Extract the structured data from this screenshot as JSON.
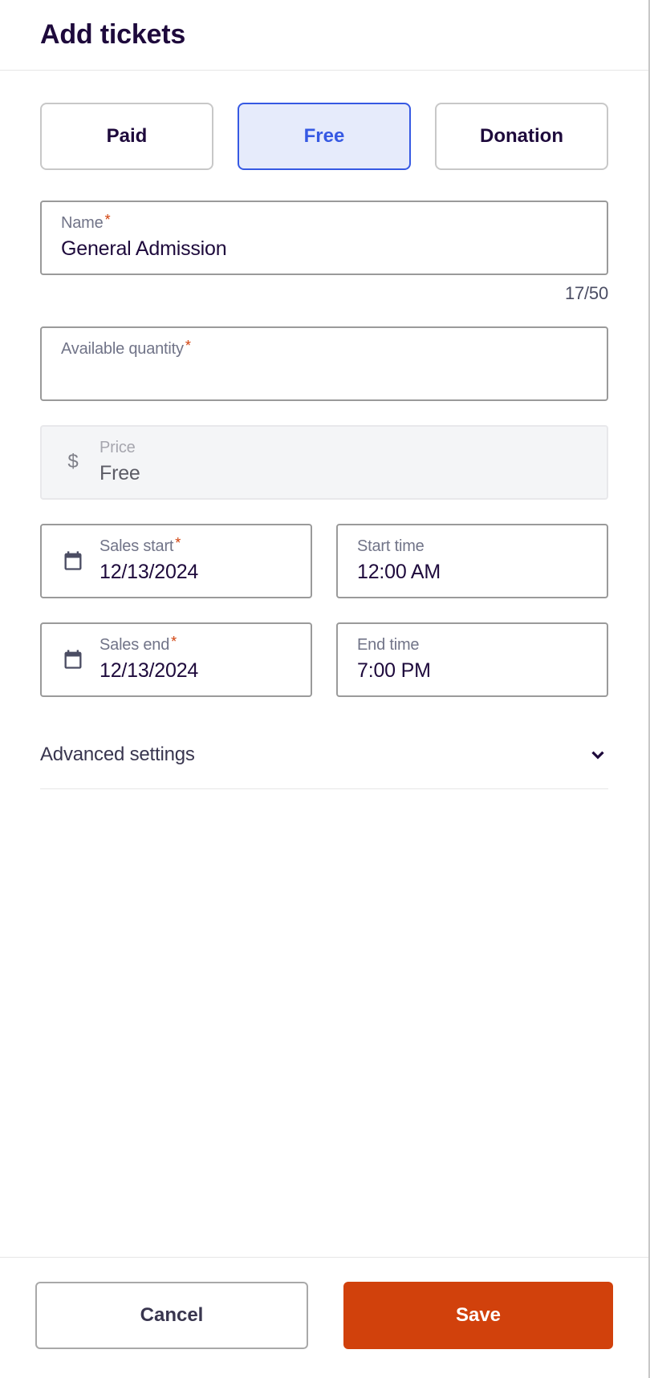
{
  "header": {
    "title": "Add tickets"
  },
  "ticketTypes": {
    "paid": "Paid",
    "free": "Free",
    "donation": "Donation",
    "active": "free"
  },
  "name": {
    "label": "Name",
    "value": "General Admission",
    "counter": "17/50"
  },
  "quantity": {
    "label": "Available quantity",
    "value": ""
  },
  "price": {
    "label": "Price",
    "value": "Free",
    "currency": "$"
  },
  "salesStart": {
    "label": "Sales start",
    "value": "12/13/2024"
  },
  "startTime": {
    "label": "Start time",
    "value": "12:00 AM"
  },
  "salesEnd": {
    "label": "Sales end",
    "value": "12/13/2024"
  },
  "endTime": {
    "label": "End time",
    "value": "7:00 PM"
  },
  "advanced": {
    "label": "Advanced settings"
  },
  "footer": {
    "cancel": "Cancel",
    "save": "Save"
  }
}
